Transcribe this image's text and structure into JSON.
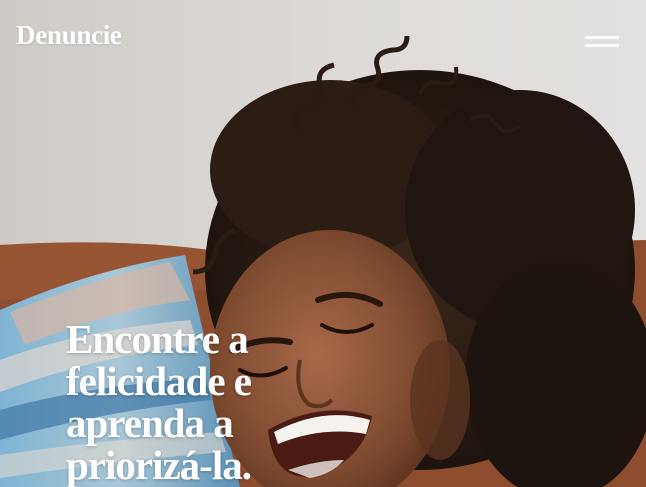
{
  "header": {
    "brand": "Denuncie",
    "menu_icon": "hamburger-menu-icon"
  },
  "hero": {
    "heading_lines": [
      "Encontre a",
      "felicidade e",
      "aprenda a",
      "priorizá-la."
    ],
    "image": "laughing-woman-curly-hair-photo"
  },
  "colors": {
    "text": "#ffffff",
    "wall": "#d6d2cd",
    "sofa": "#8a4a2c",
    "hair": "#241812",
    "skin": "#8b5537",
    "blanket_blue": "#6ea6c8"
  }
}
